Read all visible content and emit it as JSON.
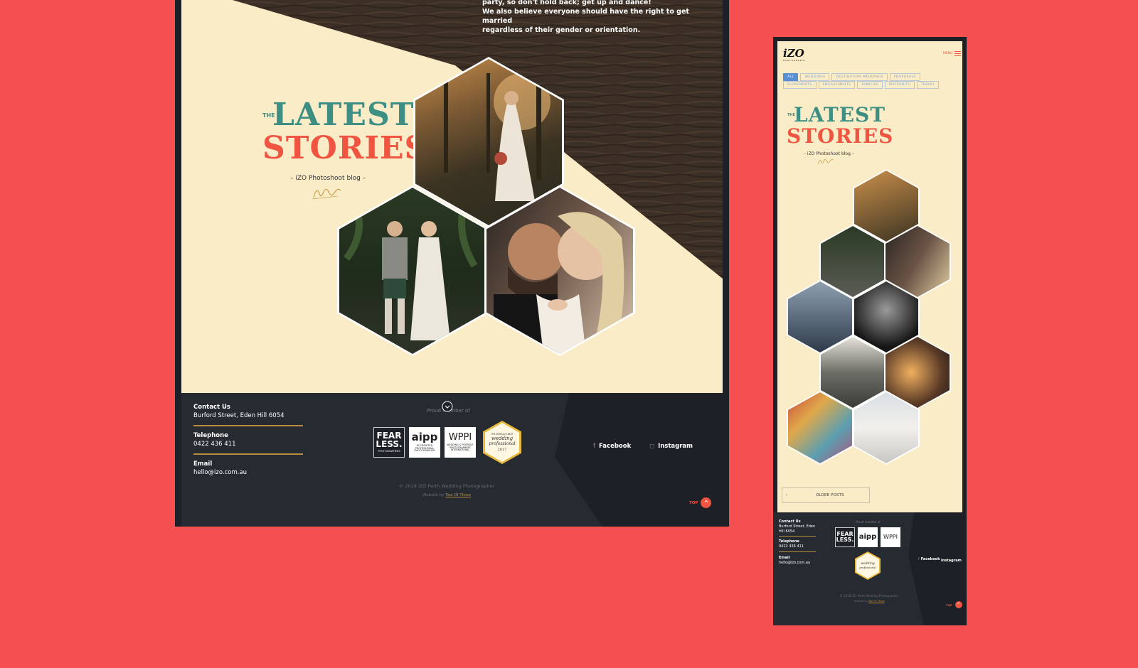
{
  "desktop": {
    "intro_lines": [
      "party, so don't hold back; get up and dance!",
      "We also believe everyone should have the right to get married",
      "regardless of their gender or orientation."
    ],
    "title": {
      "the": "THE",
      "latest": "LATEST",
      "stories": "STORIES"
    },
    "subtitle": "– iZO Photoshoot blog –",
    "signature": "iZo",
    "footer": {
      "contact_label": "Contact Us",
      "contact_value": "Burford Street, Eden Hill 6054",
      "telephone_label": "Telephone",
      "telephone_value": "0422 436 411",
      "email_label": "Email",
      "email_value": "hello@izo.com.au",
      "proud": "Proud member of",
      "badges": {
        "fearless": {
          "line1": "FEAR",
          "line2": "LESS.",
          "sub": "PHOTOGRAPHERS"
        },
        "aipp": {
          "big": "aipp",
          "sub": "ACCREDITED PROFESSIONAL PHOTOGRAPHER"
        },
        "wppi": {
          "big": "WPPI",
          "sub": "WEDDING & PORTRAIT PHOTOGRAPHERS INTERNATIONAL"
        },
        "wedding_pro": {
          "top": "THE WORLD'S BEST",
          "line1": "wedding",
          "line2": "professional",
          "year": "2017"
        }
      },
      "facebook": "Facebook",
      "instagram": "Instagram",
      "copyright": "© 2019 iZO Perth Wedding Photographer",
      "credit_prefix": "Website by ",
      "credit_link": "Two Of Three",
      "top": "TOP"
    }
  },
  "mobile": {
    "logo": "iZO",
    "logo_sub": "PHOTOGRAPHY",
    "menu": "MENU",
    "filters_row1": [
      "ALL",
      "WEDDINGS",
      "DESTINATION WEDDINGS",
      "PROPOSALS"
    ],
    "filters_row2": [
      "ELOPEMENTS",
      "ENGAGEMENTS",
      "FAMILIES",
      "MATERNITY",
      "TRAVEL"
    ],
    "active_filter": "ALL",
    "title": {
      "the": "THE",
      "latest": "LATEST",
      "stories": "STORIES"
    },
    "subtitle": "– iZO Photoshoot blog –",
    "older_posts": "OLDER POSTS",
    "footer": {
      "contact_label": "Contact Us",
      "contact_value_1": "Burford Street, Eden",
      "contact_value_2": "Hill 6054",
      "telephone_label": "Telephone",
      "telephone_value": "0422 436 411",
      "email_label": "Email",
      "email_value": "hello@izo.com.au",
      "proud": "Proud member of",
      "facebook": "Facebook",
      "instagram": "Instagram",
      "copyright": "© 2018 iZO Perth Wedding Photographer",
      "credit_prefix": "Website by ",
      "credit_link": "Two Of Three",
      "top": "TOP"
    }
  },
  "colors": {
    "background": "#f64f4f",
    "cream": "#fbecc8",
    "teal": "#3e8f83",
    "coral": "#ef5540",
    "dark": "#1d2026",
    "gold": "#b88d42"
  }
}
